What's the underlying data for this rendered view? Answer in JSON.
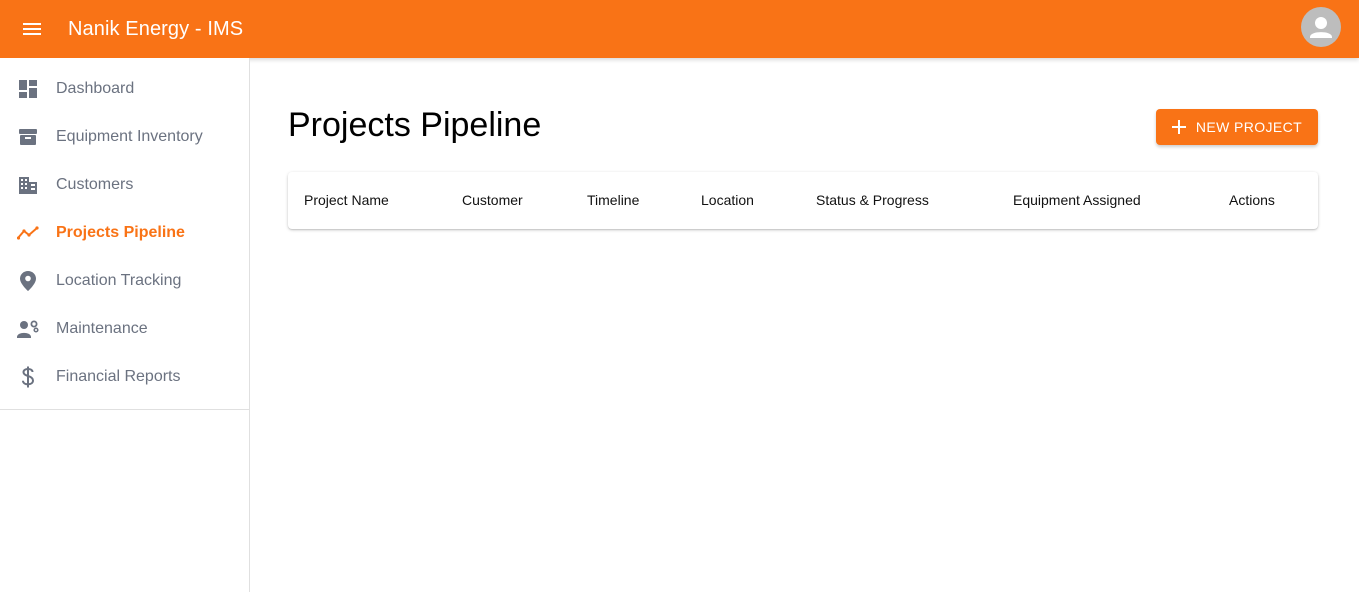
{
  "header": {
    "app_title": "Nanik Energy - IMS",
    "brand_color": "#f97316"
  },
  "sidebar": {
    "items": [
      {
        "label": "Dashboard",
        "icon": "dashboard-icon",
        "active": false
      },
      {
        "label": "Equipment Inventory",
        "icon": "archive-icon",
        "active": false
      },
      {
        "label": "Customers",
        "icon": "building-icon",
        "active": false
      },
      {
        "label": "Projects Pipeline",
        "icon": "timeline-icon",
        "active": true
      },
      {
        "label": "Location Tracking",
        "icon": "location-pin-icon",
        "active": false
      },
      {
        "label": "Maintenance",
        "icon": "engineering-icon",
        "active": false
      },
      {
        "label": "Financial Reports",
        "icon": "dollar-icon",
        "active": false
      }
    ]
  },
  "main": {
    "title": "Projects Pipeline",
    "new_project_label": "NEW PROJECT",
    "table": {
      "columns": [
        "Project Name",
        "Customer",
        "Timeline",
        "Location",
        "Status & Progress",
        "Equipment Assigned",
        "Actions"
      ]
    }
  }
}
